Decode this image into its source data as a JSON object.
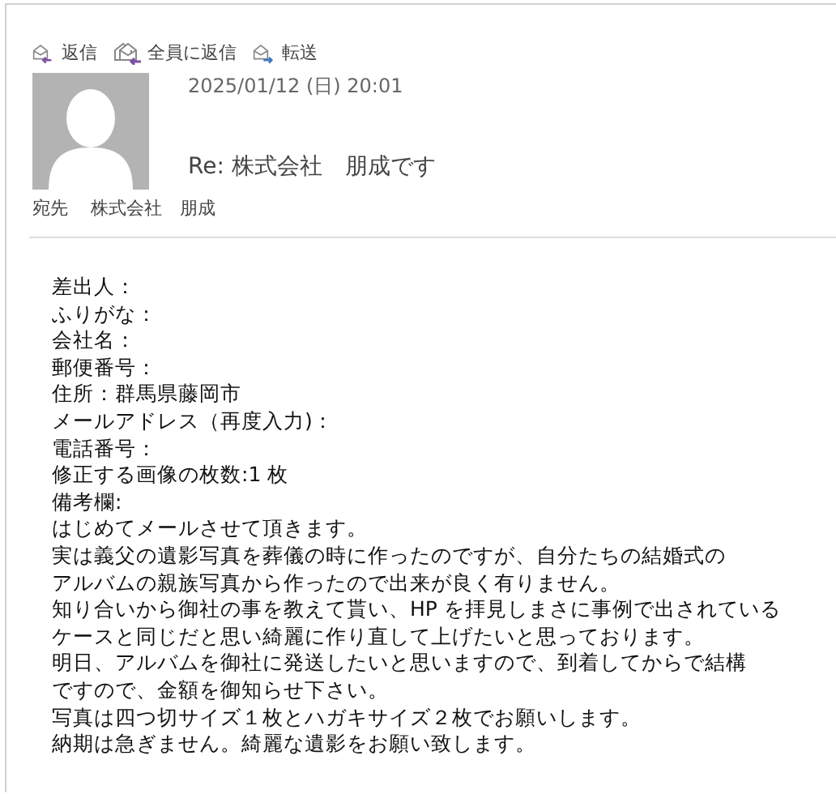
{
  "actions": [
    {
      "kind": "reply",
      "label": "返信"
    },
    {
      "kind": "reply_all",
      "label": "全員に返信"
    },
    {
      "kind": "forward",
      "label": "転送"
    }
  ],
  "message": {
    "date": "2025/01/12 (日) 20:01",
    "subject": "Re: 株式会社　朋成です",
    "to_label": "宛先",
    "to": "株式会社　朋成"
  },
  "body_lines": [
    "差出人：",
    "ふりがな：",
    "会社名：",
    "郵便番号：",
    "住所：群馬県藤岡市",
    "メールアドレス（再度入力)：",
    "電話番号：",
    "修正する画像の枚数:1 枚",
    "備考欄:",
    "はじめてメールさせて頂きます。",
    "実は義父の遺影写真を葬儀の時に作ったのですが、自分たちの結婚式の",
    "アルバムの親族写真から作ったので出来が良く有りません。",
    "知り合いから御社の事を教えて貰い、HP を拝見しまさに事例で出されている",
    "ケースと同じだと思い綺麗に作り直して上げたいと思っております。",
    "明日、アルバムを御社に発送したいと思いますので、到着してからで結構",
    "ですので、金額を御知らせ下さい。",
    "写真は四つ切サイズ１枚とハガキサイズ２枚でお願いします。",
    "納期は急ぎません。綺麗な遺影をお願い致します。"
  ]
}
